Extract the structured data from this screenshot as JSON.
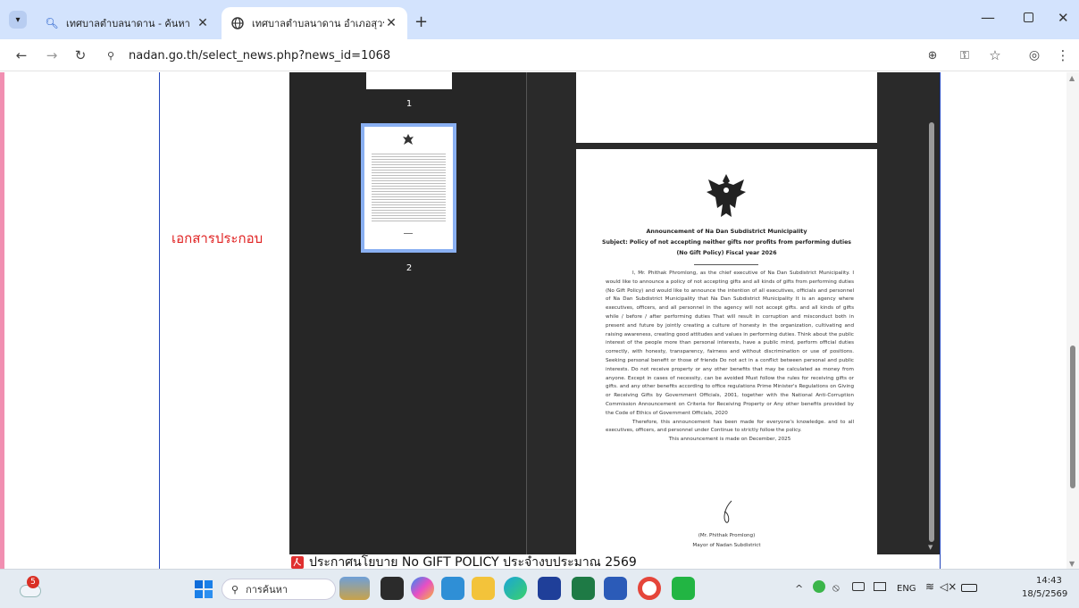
{
  "browser": {
    "tabs": [
      {
        "title": "เทศบาลตำบลนาดาน - ค้นหา",
        "icon": "search-icon"
      },
      {
        "title": "เทศบาลตำบลนาดาน อำเภอสุวรรณคู",
        "icon": "globe-icon"
      }
    ],
    "url": "nadan.go.th/select_news.php?news_id=1068"
  },
  "page": {
    "section_label": "เอกสารประกอบ",
    "thumbnails": [
      {
        "page": "1"
      },
      {
        "page": "2"
      }
    ],
    "document": {
      "heading": "Announcement of Na Dan Subdistrict Municipality",
      "subject": "Subject: Policy of not accepting neither gifts nor profits from performing duties",
      "fiscal": "(No Gift Policy)  Fiscal year 2026",
      "paragraph1": "I, Mr. Phithak Phromlong, as the chief executive of Na Dan Subdistrict Municipality. I would like to announce a policy of not accepting gifts and all kinds of gifts from performing duties (No Gift Policy) and would like to announce the intention of all executives, officials and personnel of Na Dan Subdistrict Municipality that Na Dan Subdistrict Municipality It is an agency where executives, officers, and all personnel in the agency will not accept gifts. and all kinds of gifts while / before / after performing duties That will result in corruption and misconduct both in present and future by jointly creating a culture of honesty in the organization, cultivating and raising awareness, creating good attitudes and values in performing duties. Think about the public interest of the people more than personal interests, have a public mind, perform official duties correctly, with honesty, transparency, fairness and without discrimination or use of positions. Seeking personal benefit or those of friends Do not act in a conflict between personal and public interests. Do not receive property or any other benefits that may be calculated as money from anyone. Except in cases of necessity, can be avoided Must follow the rules for receiving gifts or gifts. and any other benefits according to office regulations Prime Minister's Regulations on Giving or Receiving Gifts by Government Officials, 2001, together with the National Anti-Corruption Commission Announcement on Criteria for Receiving Property or Any other benefits provided by the Code of Ethics of Government Officials, 2020",
      "paragraph2": "Therefore, this announcement has been made for everyone's knowledge. and to all executives, officers, and personnel under Continue to strictly follow the policy.",
      "date_line": "This announcement is made on December, 2025",
      "signer_name": "(Mr. Phithak Promlong)",
      "signer_title": "Mayor of Nadan Subdistrict"
    },
    "caption": "ประกาศนโยบาย No GIFT POLICY ประจำงบประมาณ 2569"
  },
  "taskbar": {
    "search_placeholder": "การค้นหา",
    "weather_badge": "5",
    "language": "ENG",
    "time": "14:43",
    "date": "18/5/2569"
  }
}
